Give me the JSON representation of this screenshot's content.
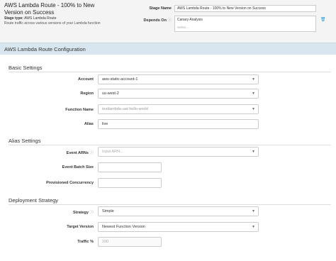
{
  "header": {
    "stage_title": "AWS Lambda Route - 100% to New Version on Success",
    "stage_type_label": "Stage type:",
    "stage_type_value": "AWS Lambda Route",
    "stage_description": "Route traffic across various versions of your Lambda function",
    "stage_name_label": "Stage Name",
    "stage_name_value": "AWS Lambda Route - 100% to New Version on Success",
    "depends_on_label": "Depends On",
    "depends_on_tag": "Canary Analysis",
    "depends_on_placeholder": "Select..."
  },
  "config": {
    "title": "AWS Lambda Route Configuration"
  },
  "basic": {
    "title": "Basic Settings",
    "account_label": "Account",
    "account_value": "aws-static-account-1",
    "region_label": "Region",
    "region_value": "us-west-2",
    "function_label": "Function Name",
    "function_value": "testlambda-uat-hello-world",
    "alias_label": "Alias",
    "alias_value": "live"
  },
  "alias": {
    "title": "Alias Settings",
    "event_arns_label": "Event ARNs",
    "event_arns_placeholder": "Input ARN...",
    "batch_size_label": "Event Batch Size",
    "batch_size_value": "",
    "concurrency_label": "Provisioned Concurrency",
    "concurrency_value": ""
  },
  "deployment": {
    "title": "Deployment Strategy",
    "strategy_label": "Strategy",
    "strategy_value": "Simple",
    "target_label": "Target Version",
    "target_value": "Newest Function Version",
    "traffic_label": "Traffic %",
    "traffic_value": "100"
  },
  "icons": {
    "help": "help-circle-icon",
    "caret": "caret-down-icon",
    "trash": "trash-icon"
  },
  "colors": {
    "accent": "#2a9fd6",
    "config_bar": "#d8e6ef",
    "header_bg": "#f4f4f4"
  }
}
